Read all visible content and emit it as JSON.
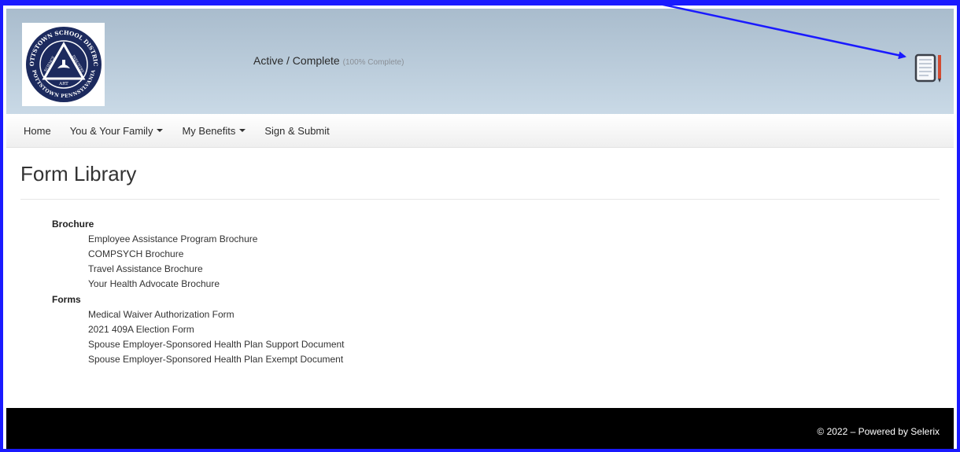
{
  "header": {
    "logo_alt": "Pottstown School District seal",
    "logo_text": {
      "outer_top": "POTTSTOWN SCHOOL DISTRICT",
      "outer_bottom": "POTTSTOWN PENNSYLVANIA",
      "inner_left": "SCIENCE",
      "inner_right": "INDUSTRY",
      "inner_bottom": "ART"
    },
    "status_label": "Active / Complete",
    "status_percent": "(100% Complete)",
    "notepad_icon": "notepad-icon"
  },
  "nav": {
    "items": [
      {
        "label": "Home",
        "dropdown": false
      },
      {
        "label": "You & Your Family",
        "dropdown": true
      },
      {
        "label": "My Benefits",
        "dropdown": true
      },
      {
        "label": "Sign & Submit",
        "dropdown": false
      }
    ]
  },
  "page": {
    "title": "Form Library",
    "sections": [
      {
        "title": "Brochure",
        "items": [
          "Employee Assistance Program Brochure",
          "COMPSYCH Brochure",
          "Travel Assistance Brochure",
          "Your Health Advocate Brochure"
        ]
      },
      {
        "title": "Forms",
        "items": [
          "Medical Waiver Authorization Form",
          "2021 409A Election Form",
          "Spouse Employer-Sponsored Health Plan Support Document",
          "Spouse Employer-Sponsored Health Plan Exempt Document"
        ]
      }
    ]
  },
  "footer": {
    "text": "© 2022 – Powered by Selerix"
  },
  "colors": {
    "frame_border": "#1a1aff",
    "annotation_arrow": "#1a1aff",
    "footer_bg": "#000000",
    "seal_blue": "#1c2a5e"
  }
}
